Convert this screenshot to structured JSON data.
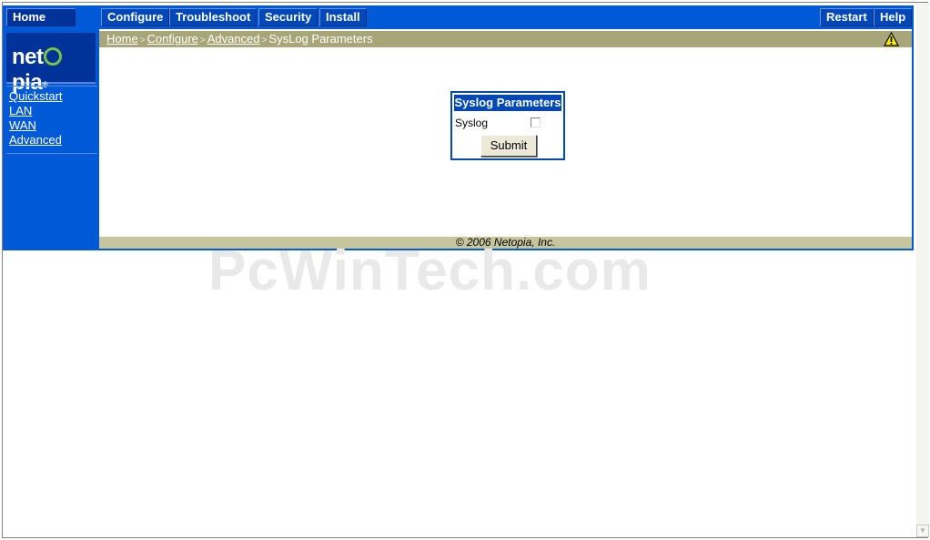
{
  "nav": {
    "home": "Home",
    "configure": "Configure",
    "troubleshoot": "Troubleshoot",
    "security": "Security",
    "install": "Install",
    "restart": "Restart",
    "help": "Help"
  },
  "logo": {
    "brand": "netopia"
  },
  "sidebar": {
    "items": [
      {
        "label": "Quickstart"
      },
      {
        "label": "LAN"
      },
      {
        "label": "WAN"
      },
      {
        "label": "Advanced"
      }
    ]
  },
  "breadcrumb": {
    "home": "Home",
    "configure": "Configure",
    "advanced": "Advanced",
    "current": "SysLog Parameters",
    "separator": ">"
  },
  "panel": {
    "title": "Syslog Parameters",
    "syslog_label": "Syslog",
    "syslog_checked": false,
    "submit_label": "Submit"
  },
  "footer": {
    "copyright": "© 2006 Netopia, Inc."
  },
  "watermark": "PcWinTech.com",
  "icons": {
    "warning": "warning-icon"
  },
  "colors": {
    "nav_blue": "#0059d6",
    "button_blue": "#0047b8",
    "breadcrumb_bar": "#a8a678",
    "footer_bar": "#c6c59b",
    "logo_green": "#7ac143"
  }
}
